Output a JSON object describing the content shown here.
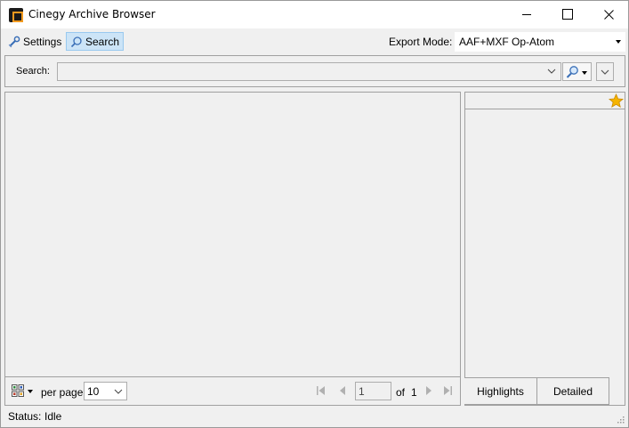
{
  "window": {
    "title": "Cinegy Archive Browser"
  },
  "menu": {
    "settings_label": "Settings",
    "search_label": "Search",
    "export_mode_label": "Export Mode:",
    "export_mode_value": "AAF+MXF Op-Atom"
  },
  "search": {
    "label": "Search:",
    "query_value": ""
  },
  "pager": {
    "per_page_label": "per page:",
    "per_page_value": "10",
    "current_page": "1",
    "of_label": "of",
    "total_pages": "1"
  },
  "detail": {
    "tabs": [
      {
        "label": "Highlights"
      },
      {
        "label": "Detailed"
      }
    ]
  },
  "status": {
    "label": "Status:",
    "value": "Idle"
  },
  "colors": {
    "selected_menu_bg": "#cce4f7",
    "panel_bg": "#f0f0f0",
    "app_icon_accent": "#f29a1f",
    "star": "#f5b400"
  }
}
